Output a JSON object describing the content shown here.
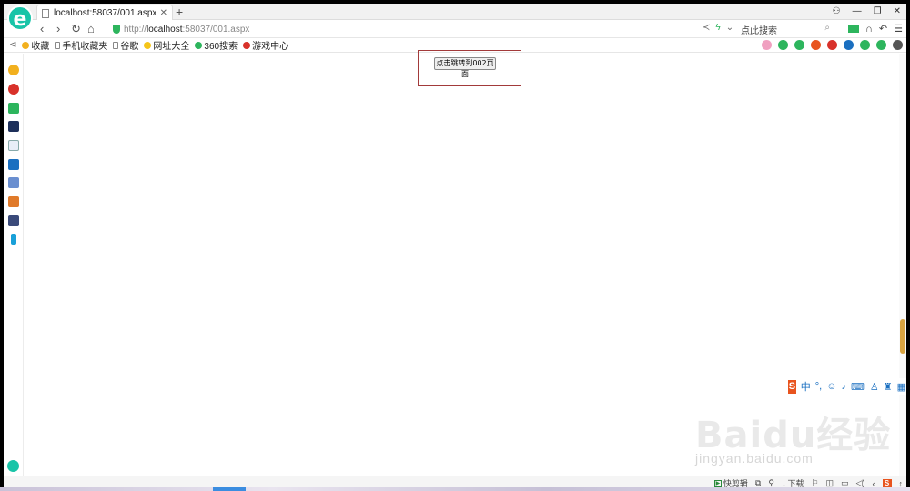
{
  "browser": {
    "tab_title": "localhost:58037/001.aspx",
    "url_scheme": "http://",
    "url_host": "localhost",
    "url_path": ":58037/001.aspx",
    "search_placeholder": "点此搜索",
    "logo_letter": "e"
  },
  "bookmarks": [
    {
      "label": "收藏"
    },
    {
      "label": "手机收藏夹"
    },
    {
      "label": "谷歌"
    },
    {
      "label": "网址大全"
    },
    {
      "label": "360搜索"
    },
    {
      "label": "游戏中心"
    }
  ],
  "page": {
    "button_label": "点击跳转到002页面"
  },
  "ime": {
    "logo": "S",
    "mode": "中"
  },
  "watermark": {
    "brand": "Baidu经验",
    "sub": "jingyan.baidu.com"
  },
  "status": {
    "quick_clip": "快剪辑",
    "download": "下载",
    "sohu": "S"
  },
  "colors": {
    "accent": "#19c4a8",
    "highlight_border": "#a23a3a",
    "scroll_thumb": "#d9a441"
  }
}
